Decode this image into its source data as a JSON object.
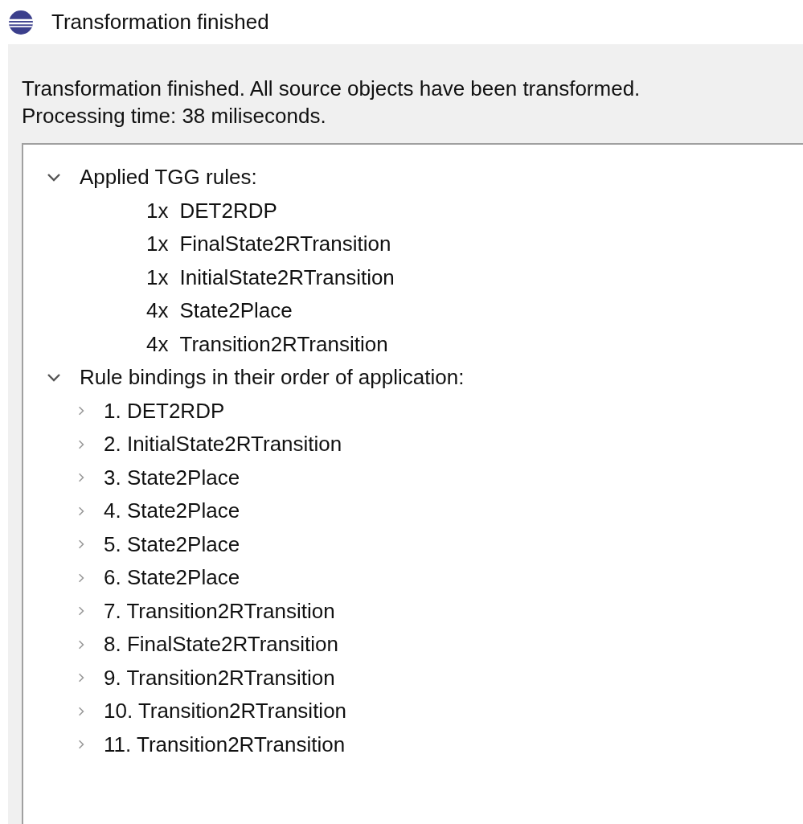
{
  "window": {
    "title": "Transformation finished"
  },
  "message": {
    "lines": [
      "Transformation finished. All source objects have been transformed.",
      "Processing time: 38 miliseconds."
    ]
  },
  "tree": [
    {
      "kind": "group",
      "label": "Applied TGG rules:",
      "expanded": true,
      "children": [
        {
          "kind": "count",
          "count": "1x",
          "rule": "DET2RDP"
        },
        {
          "kind": "count",
          "count": "1x",
          "rule": "FinalState2RTransition"
        },
        {
          "kind": "count",
          "count": "1x",
          "rule": "InitialState2RTransition"
        },
        {
          "kind": "count",
          "count": "4x",
          "rule": "State2Place"
        },
        {
          "kind": "count",
          "count": "4x",
          "rule": "Transition2RTransition"
        }
      ]
    },
    {
      "kind": "group",
      "label": "Rule bindings in their order of application:",
      "expanded": true,
      "children": [
        {
          "kind": "group",
          "label": "1. DET2RDP",
          "expanded": false
        },
        {
          "kind": "group",
          "label": "2. InitialState2RTransition",
          "expanded": false
        },
        {
          "kind": "group",
          "label": "3. State2Place",
          "expanded": false
        },
        {
          "kind": "group",
          "label": "4. State2Place",
          "expanded": false
        },
        {
          "kind": "group",
          "label": "5. State2Place",
          "expanded": false
        },
        {
          "kind": "group",
          "label": "6. State2Place",
          "expanded": false
        },
        {
          "kind": "group",
          "label": "7. Transition2RTransition",
          "expanded": false
        },
        {
          "kind": "group",
          "label": "8. FinalState2RTransition",
          "expanded": false
        },
        {
          "kind": "group",
          "label": "9. Transition2RTransition",
          "expanded": false
        },
        {
          "kind": "group",
          "label": "10. Transition2RTransition",
          "expanded": false
        },
        {
          "kind": "group",
          "label": "11. Transition2RTransition",
          "expanded": false
        }
      ]
    }
  ]
}
